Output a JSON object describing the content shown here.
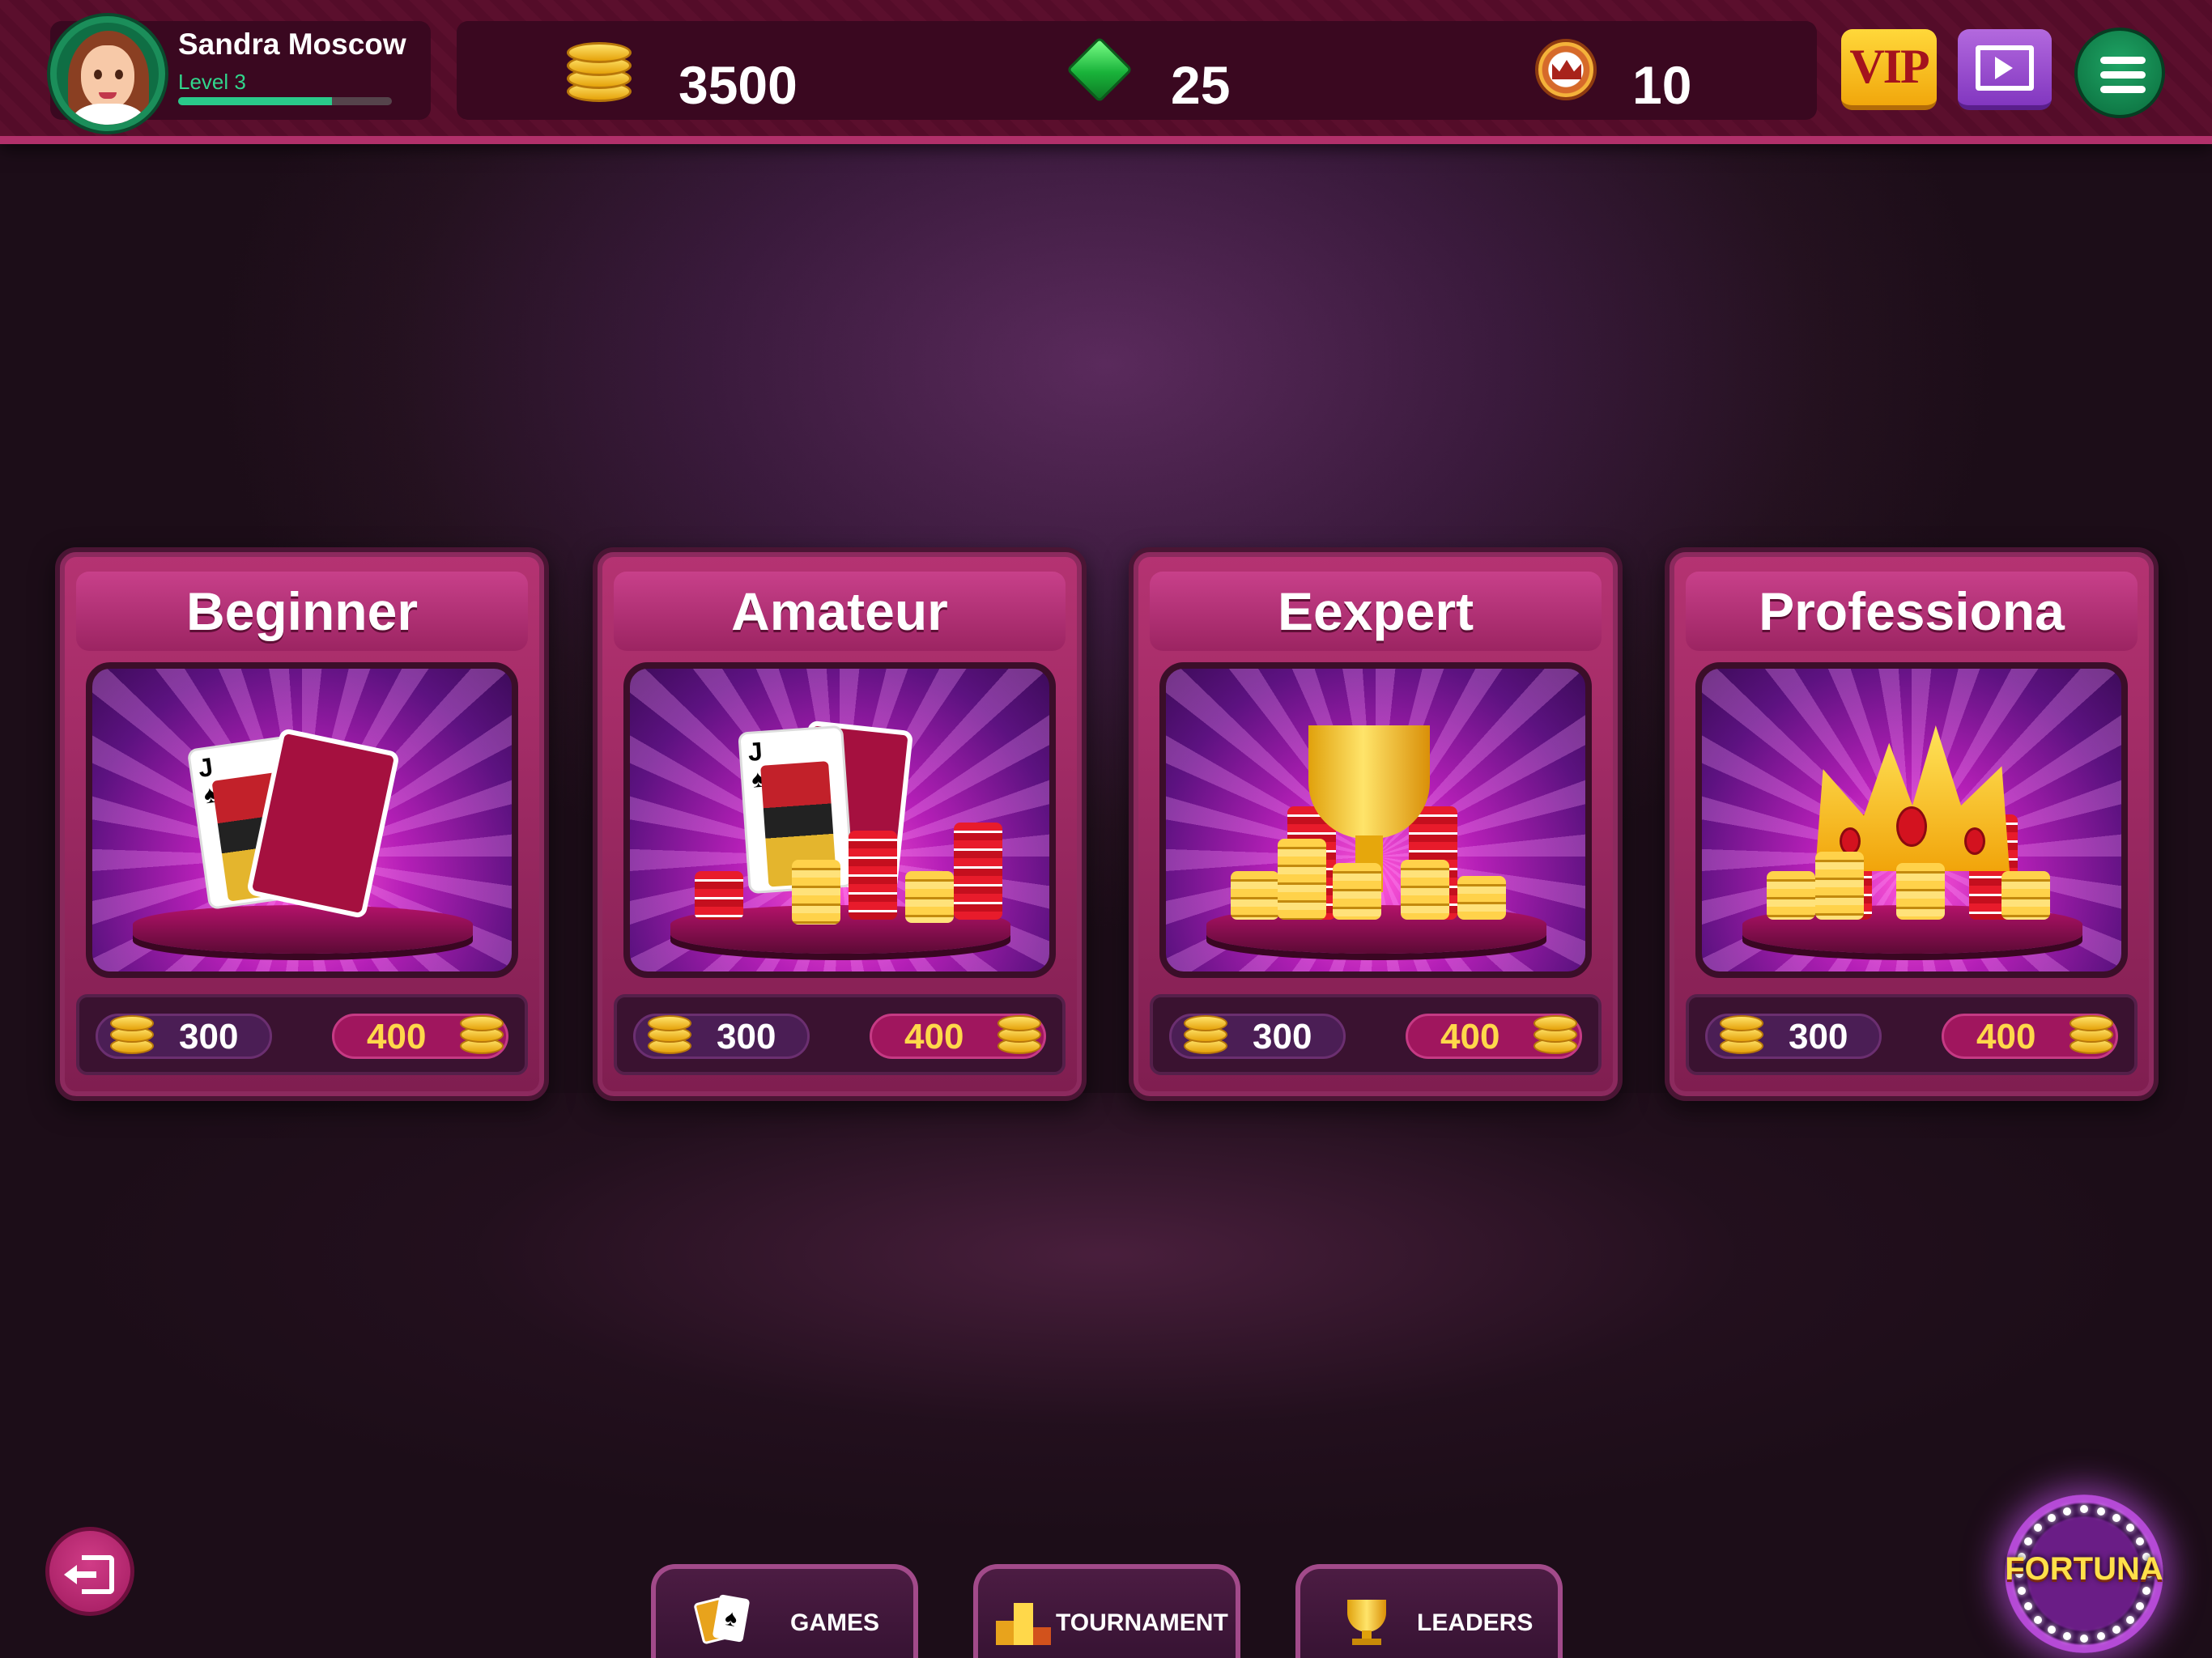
{
  "player": {
    "name": "Sandra Moscow",
    "level": "Level 3",
    "xp_progress": 0.72
  },
  "currencies": {
    "coins": "3500",
    "gems": "25",
    "crowns": "10"
  },
  "header_buttons": {
    "vip_label": "VIP"
  },
  "levels": [
    {
      "title": "Beginner",
      "entry_fee": "300",
      "prize": "400",
      "art": "playing-cards"
    },
    {
      "title": "Amateur",
      "entry_fee": "300",
      "prize": "400",
      "art": "cards-and-chips"
    },
    {
      "title": "Eexpert",
      "entry_fee": "300",
      "prize": "400",
      "art": "trophy-and-chips"
    },
    {
      "title": "Professiona",
      "entry_fee": "300",
      "prize": "400",
      "art": "crown-and-chips"
    }
  ],
  "bottom_nav": {
    "tabs": [
      {
        "label": "GAMES",
        "icon": "cards-icon"
      },
      {
        "label": "TOURNAMENT",
        "icon": "podium-icon"
      },
      {
        "label": "LEADERS",
        "icon": "trophy-icon"
      }
    ]
  },
  "fortuna": {
    "label": "FORTUNA"
  },
  "colors": {
    "accent_pink": "#b53372",
    "gold_text": "#ffd84a",
    "level_green": "#31d68c",
    "menu_green": "#1fa565",
    "vip_gold": "#ffd83a"
  }
}
